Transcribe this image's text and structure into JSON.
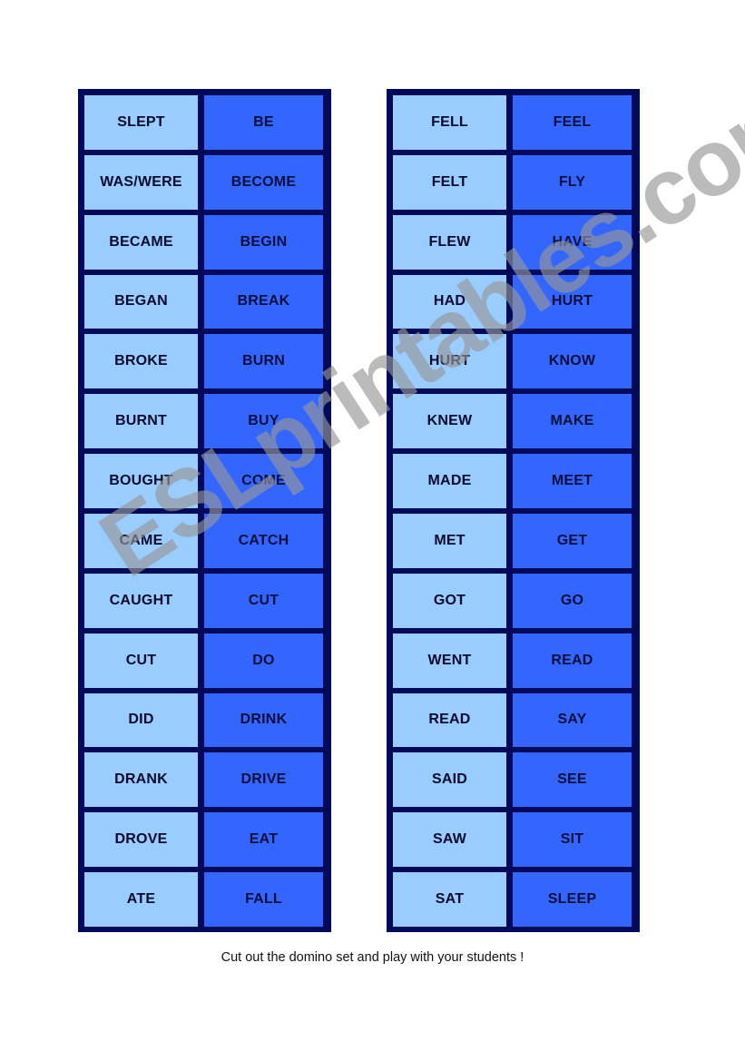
{
  "tables": [
    {
      "rows": [
        [
          "SLEPT",
          "BE"
        ],
        [
          "WAS/WERE",
          "BECOME"
        ],
        [
          "BECAME",
          "BEGIN"
        ],
        [
          "BEGAN",
          "BREAK"
        ],
        [
          "BROKE",
          "BURN"
        ],
        [
          "BURNT",
          "BUY"
        ],
        [
          "BOUGHT",
          "COME"
        ],
        [
          "CAME",
          "CATCH"
        ],
        [
          "CAUGHT",
          "CUT"
        ],
        [
          "CUT",
          "DO"
        ],
        [
          "DID",
          "DRINK"
        ],
        [
          "DRANK",
          "DRIVE"
        ],
        [
          "DROVE",
          "EAT"
        ],
        [
          "ATE",
          "FALL"
        ]
      ]
    },
    {
      "rows": [
        [
          "FELL",
          "FEEL"
        ],
        [
          "FELT",
          "FLY"
        ],
        [
          "FLEW",
          "HAVE"
        ],
        [
          "HAD",
          "HURT"
        ],
        [
          "HURT",
          "KNOW"
        ],
        [
          "KNEW",
          "MAKE"
        ],
        [
          "MADE",
          "MEET"
        ],
        [
          "MET",
          "GET"
        ],
        [
          "GOT",
          "GO"
        ],
        [
          "WENT",
          "READ"
        ],
        [
          "READ",
          "SAY"
        ],
        [
          "SAID",
          "SEE"
        ],
        [
          "SAW",
          "SIT"
        ],
        [
          "SAT",
          "SLEEP"
        ]
      ]
    }
  ],
  "caption": "Cut out the domino set and play with your students !",
  "watermark": "ESLprintables.com",
  "colors": {
    "border": "#000a5a",
    "past_cell": "#99ccff",
    "base_cell": "#3366ff"
  }
}
